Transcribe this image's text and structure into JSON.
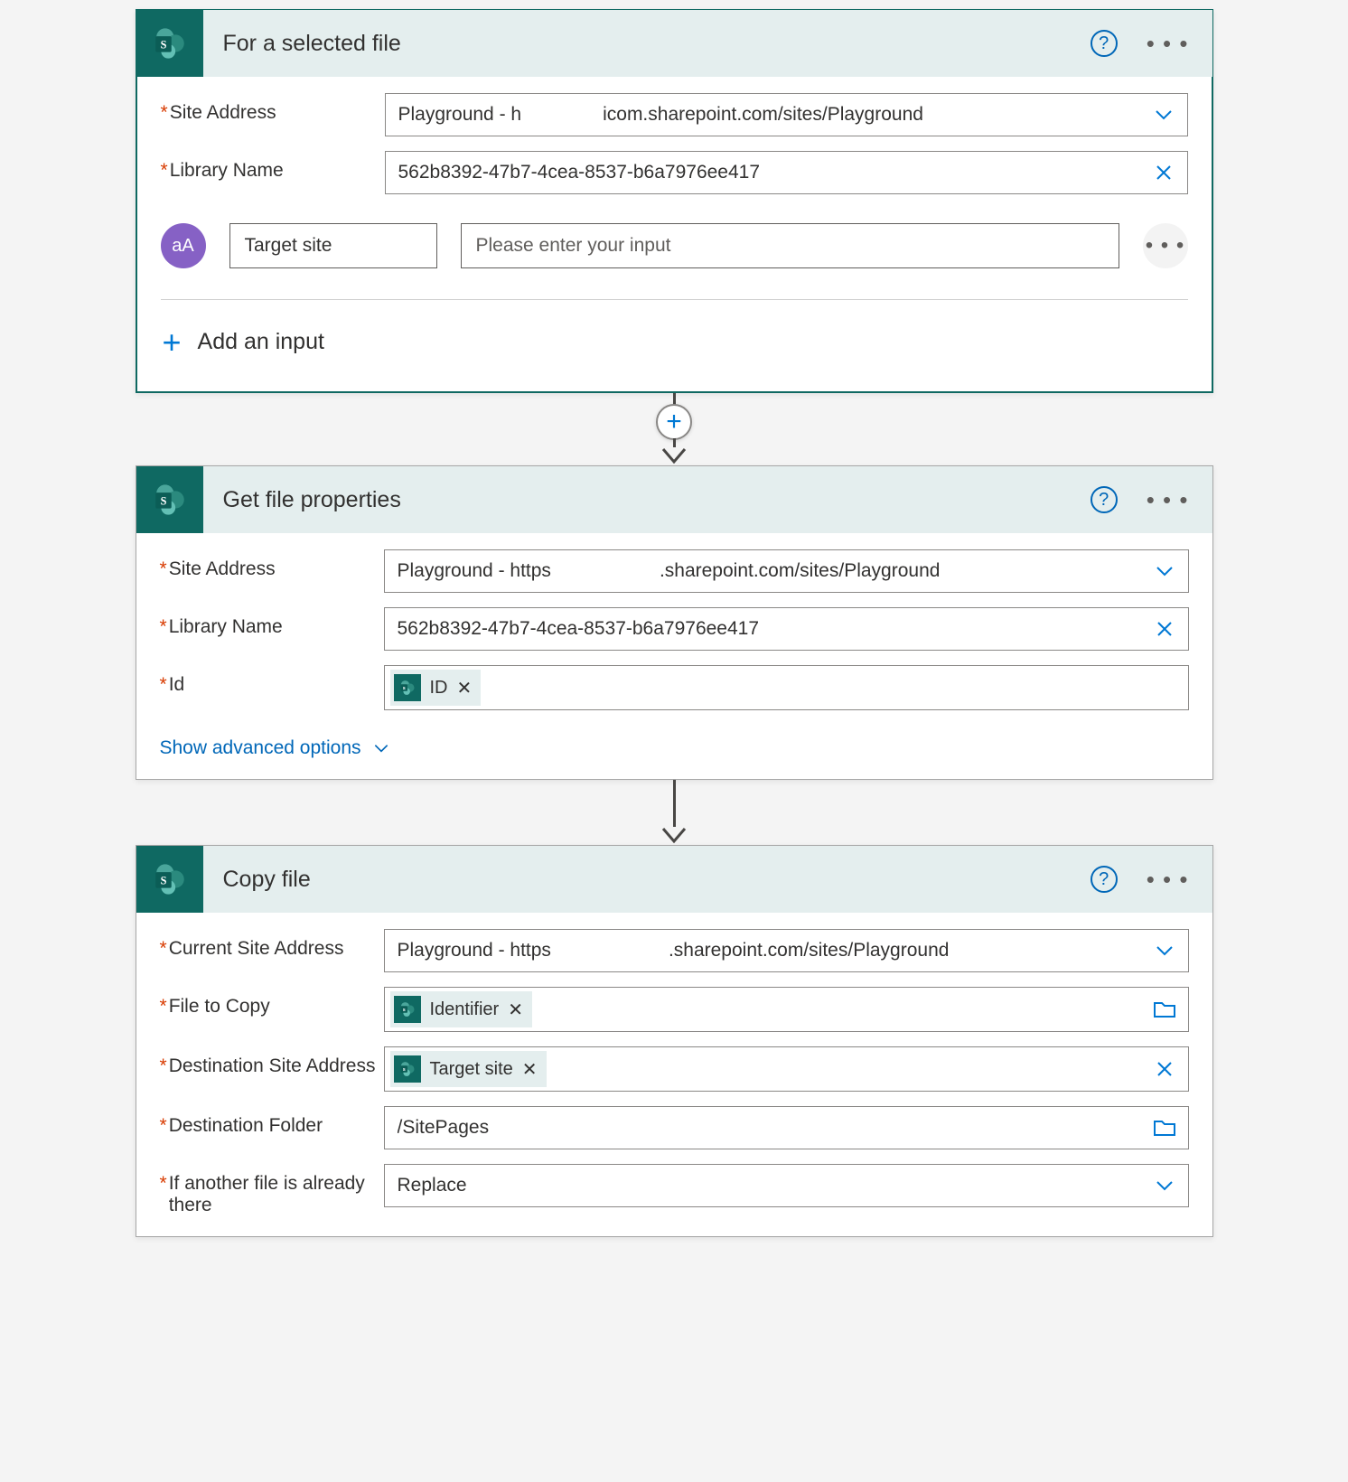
{
  "accent": "#0f6962",
  "link_color": "#0067b8",
  "steps": {
    "trigger": {
      "title": "For a selected file",
      "fields": {
        "site_address": {
          "label": "Site Address",
          "value_part1": "Playground - h",
          "value_part2": "icom.sharepoint.com/sites/Playground"
        },
        "library_name": {
          "label": "Library Name",
          "value": "562b8392-47b7-4cea-8537-b6a7976ee417"
        }
      },
      "user_input": {
        "badge": "aA",
        "name": "Target site",
        "placeholder": "Please enter your input"
      },
      "add_input_label": "Add an input"
    },
    "get_props": {
      "title": "Get file properties",
      "fields": {
        "site_address": {
          "label": "Site Address",
          "value_part1": "Playground - https",
          "value_part2": ".sharepoint.com/sites/Playground"
        },
        "library_name": {
          "label": "Library Name",
          "value": "562b8392-47b7-4cea-8537-b6a7976ee417"
        },
        "id": {
          "label": "Id",
          "token": "ID"
        }
      },
      "advanced_label": "Show advanced options"
    },
    "copy_file": {
      "title": "Copy file",
      "fields": {
        "current_site": {
          "label": "Current Site Address",
          "value_part1": "Playground - https",
          "value_part2": ".sharepoint.com/sites/Playground"
        },
        "file_to_copy": {
          "label": "File to Copy",
          "token": "Identifier"
        },
        "dest_site": {
          "label": "Destination Site Address",
          "token": "Target site"
        },
        "dest_folder": {
          "label": "Destination Folder",
          "value": "/SitePages"
        },
        "if_exists": {
          "label": "If another file is already there",
          "value": "Replace"
        }
      }
    }
  }
}
